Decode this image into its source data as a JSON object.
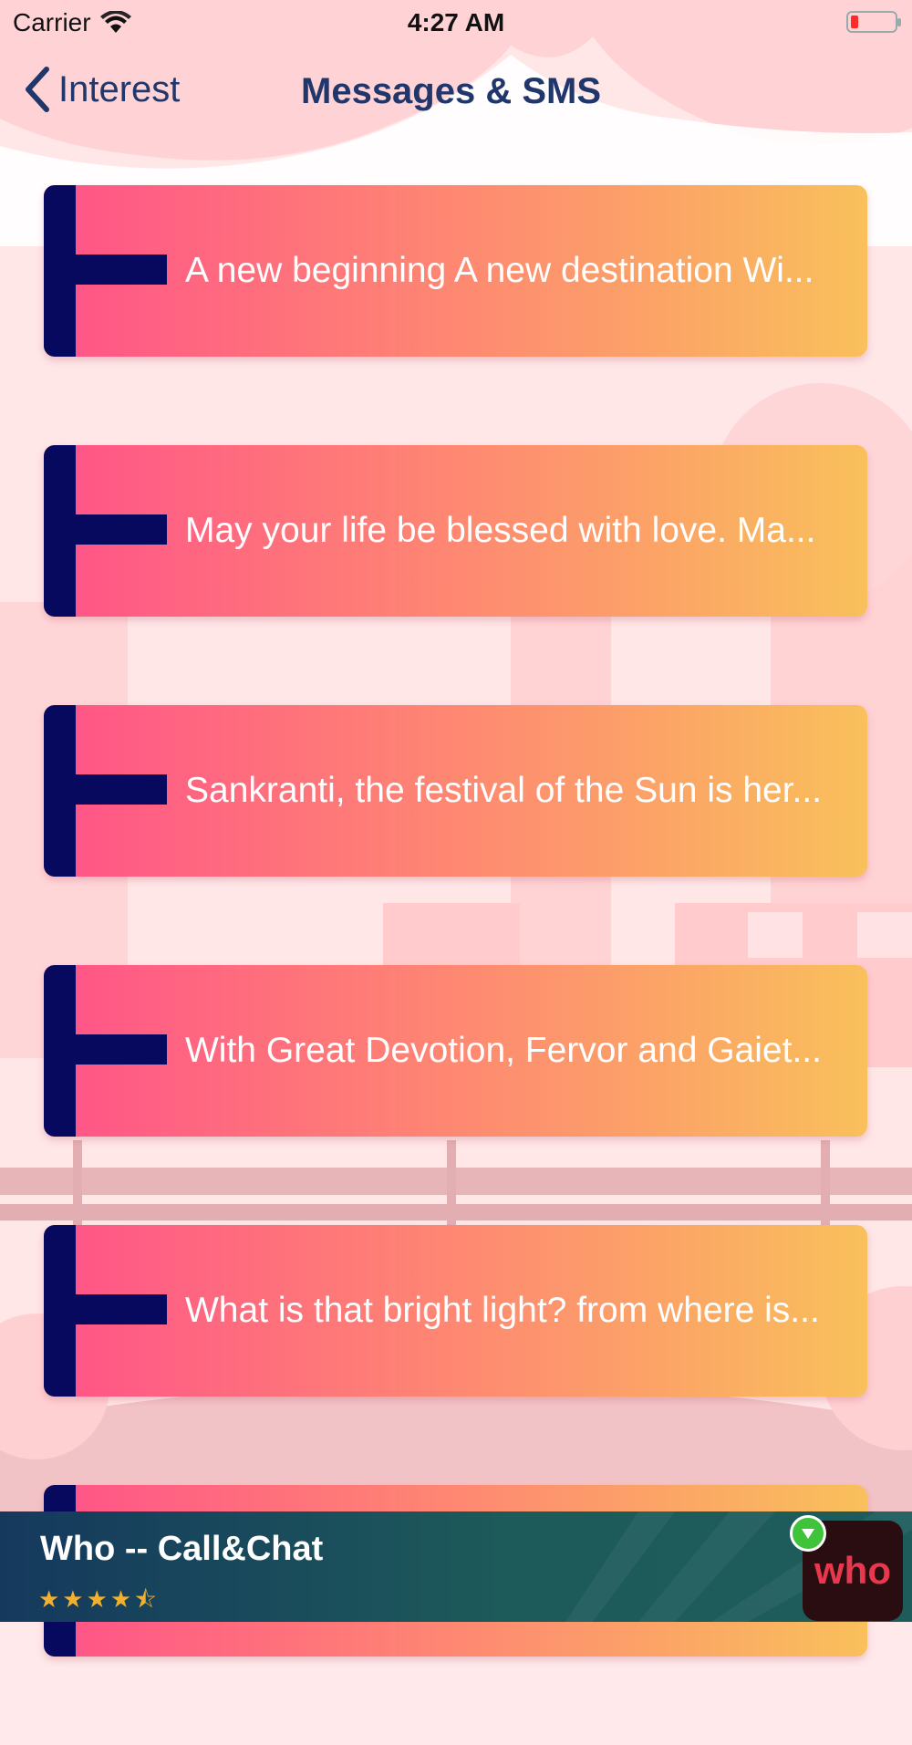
{
  "status_bar": {
    "carrier": "Carrier",
    "time": "4:27 AM",
    "battery_color": "#ff2a2a"
  },
  "nav": {
    "back_label": "Interest",
    "title": "Messages & SMS"
  },
  "messages": [
    {
      "text": "A new beginning A new destination Wi..."
    },
    {
      "text": "May your life be blessed with love. Ma..."
    },
    {
      "text": "Sankranti, the festival of the Sun is her..."
    },
    {
      "text": "With Great Devotion, Fervor and Gaiet..."
    },
    {
      "text": "What is that bright light? from where is..."
    },
    {
      "text": ""
    }
  ],
  "ad": {
    "title": "Who -- Call&Chat",
    "rating_stars": "★★★★⯪",
    "rating": 4.5,
    "logo_text": "who"
  },
  "colors": {
    "accent_navy": "#07095e",
    "title_blue": "#21376b",
    "gradient_start": "#ff5289",
    "gradient_end": "#f9c05b",
    "background": "#ffe9ea"
  }
}
